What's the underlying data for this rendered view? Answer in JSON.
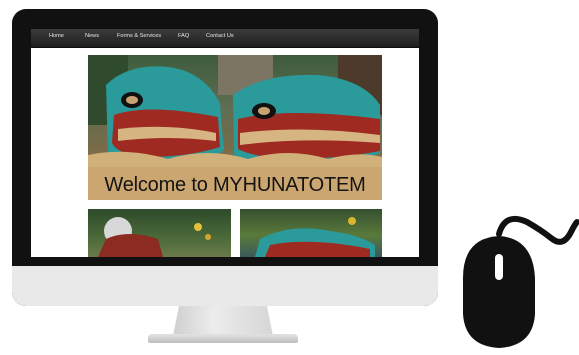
{
  "nav": {
    "items": [
      "Home",
      "News",
      "Forms & Services",
      "FAQ",
      "Contact Us"
    ]
  },
  "hero": {
    "title": "Welcome to MYHUNATOTEM"
  },
  "colors": {
    "monitor_bezel": "#111111",
    "monitor_chin": "#e9e9e9",
    "nav_bar": "#2a2a2a",
    "totem_teal": "#2a9a9b",
    "totem_red": "#9e2a22",
    "mouse": "#111111"
  },
  "icons": [
    "computer-mouse-icon"
  ]
}
